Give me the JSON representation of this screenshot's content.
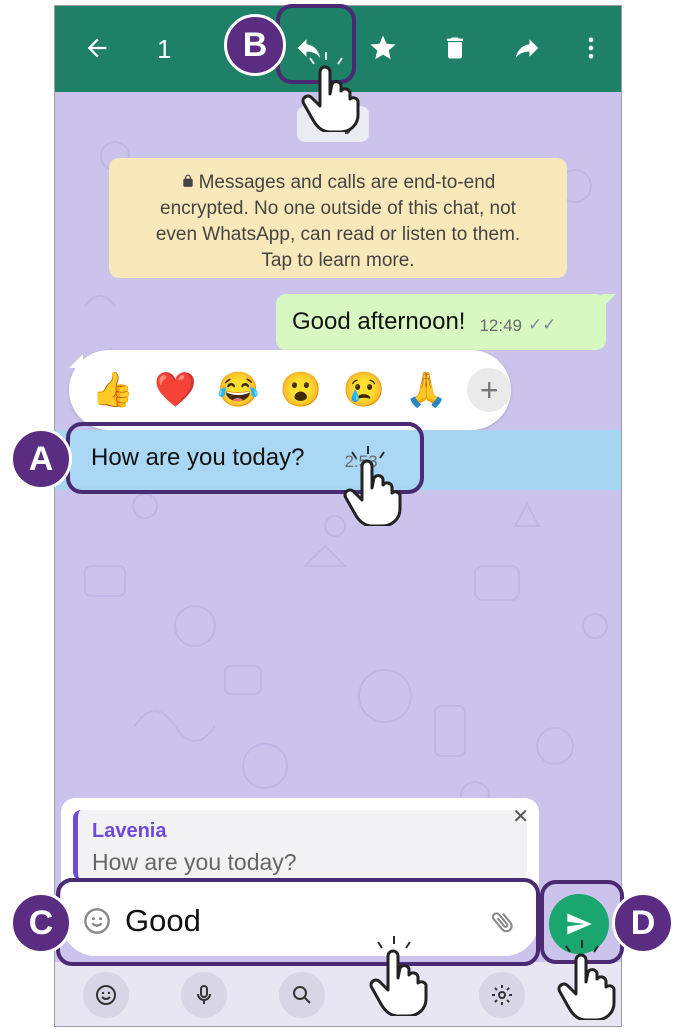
{
  "topbar": {
    "selected_count": "1"
  },
  "date_chip": "ay",
  "encryption_notice": {
    "line1": "Messages and calls are end-to-end",
    "line2": "encrypted. No one outside of this chat, not",
    "line3": "even WhatsApp, can read or listen to them.",
    "line4": "Tap to learn more."
  },
  "messages": [
    {
      "text": "Good afternoon!",
      "time": "12:49",
      "direction": "outgoing",
      "status": "read"
    },
    {
      "text": "How are you today?",
      "time": "2:53",
      "direction": "incoming",
      "selected": true
    }
  ],
  "reactions": [
    "👍",
    "❤️",
    "😂",
    "😮",
    "😢",
    "🙏"
  ],
  "reply_preview": {
    "name": "Lavenia",
    "text": "How are you today?"
  },
  "composer": {
    "value": "Good"
  },
  "annotations": {
    "a": "A",
    "b": "B",
    "c": "C",
    "d": "D"
  },
  "colors": {
    "header": "#1d8067",
    "accent": "#5a2d82",
    "outgoing": "#d8f8c2",
    "selected": "#aad7f3",
    "send": "#1aa66e"
  }
}
